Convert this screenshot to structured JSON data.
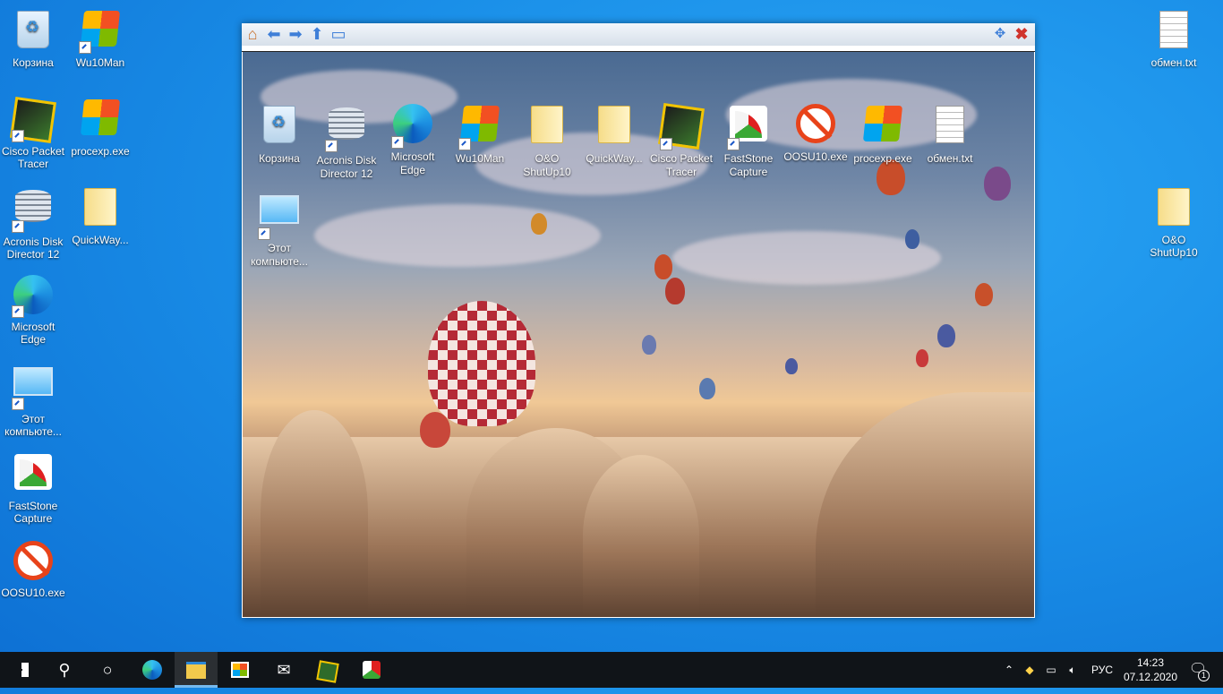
{
  "desktop": {
    "left_icons": [
      {
        "label": "Корзина",
        "icon": "recycle-bin-icon"
      },
      {
        "label": "Wu10Man",
        "icon": "wu10man-icon"
      },
      {
        "label": "Cisco Packet Tracer",
        "icon": "cisco-packet-tracer-icon"
      },
      {
        "label": "procexp.exe",
        "icon": "procexp-icon"
      },
      {
        "label": "Acronis Disk Director 12",
        "icon": "acronis-icon"
      },
      {
        "label": "QuickWay...",
        "icon": "folder-icon"
      },
      {
        "label": "Microsoft Edge",
        "icon": "edge-icon"
      },
      {
        "label": "Этот компьюте...",
        "icon": "this-pc-icon"
      },
      {
        "label": "FastStone Capture",
        "icon": "faststone-icon"
      },
      {
        "label": "OOSU10.exe",
        "icon": "oosu10-icon"
      }
    ],
    "right_icons": [
      {
        "label": "обмен.txt",
        "icon": "text-file-icon"
      },
      {
        "label": "O&O ShutUp10",
        "icon": "folder-icon"
      }
    ]
  },
  "viewer": {
    "toolbar": {
      "home": "home-icon",
      "back": "back-arrow-icon",
      "forward": "forward-arrow-icon",
      "up": "up-arrow-icon",
      "open": "open-folder-icon",
      "resize": "resize-icon",
      "close": "close-icon"
    },
    "preview_icons": [
      {
        "label": "Корзина",
        "icon": "recycle-bin-icon"
      },
      {
        "label": "Acronis Disk Director 12",
        "icon": "acronis-icon"
      },
      {
        "label": "Microsoft Edge",
        "icon": "edge-icon"
      },
      {
        "label": "Wu10Man",
        "icon": "wu10man-icon"
      },
      {
        "label": "O&O ShutUp10",
        "icon": "folder-icon"
      },
      {
        "label": "QuickWay...",
        "icon": "folder-icon"
      },
      {
        "label": "Cisco Packet Tracer",
        "icon": "cisco-packet-tracer-icon"
      },
      {
        "label": "FastStone Capture",
        "icon": "faststone-icon"
      },
      {
        "label": "OOSU10.exe",
        "icon": "oosu10-icon"
      },
      {
        "label": "procexp.exe",
        "icon": "procexp-icon"
      },
      {
        "label": "обмен.txt",
        "icon": "text-file-icon"
      },
      {
        "label": "Этот компьюте...",
        "icon": "this-pc-icon"
      }
    ]
  },
  "taskbar": {
    "apps": [
      "start-icon",
      "search-icon",
      "task-view-icon",
      "edge-icon",
      "file-explorer-icon",
      "store-icon",
      "mail-icon",
      "cisco-packet-tracer-icon",
      "faststone-icon"
    ],
    "tray": {
      "language": "РУС",
      "time": "14:23",
      "date": "07.12.2020",
      "notifications": "1"
    }
  },
  "colors": {
    "desktop_bg": "#1a8fe8",
    "taskbar_bg": "#101418",
    "accent": "#76b9ed"
  }
}
